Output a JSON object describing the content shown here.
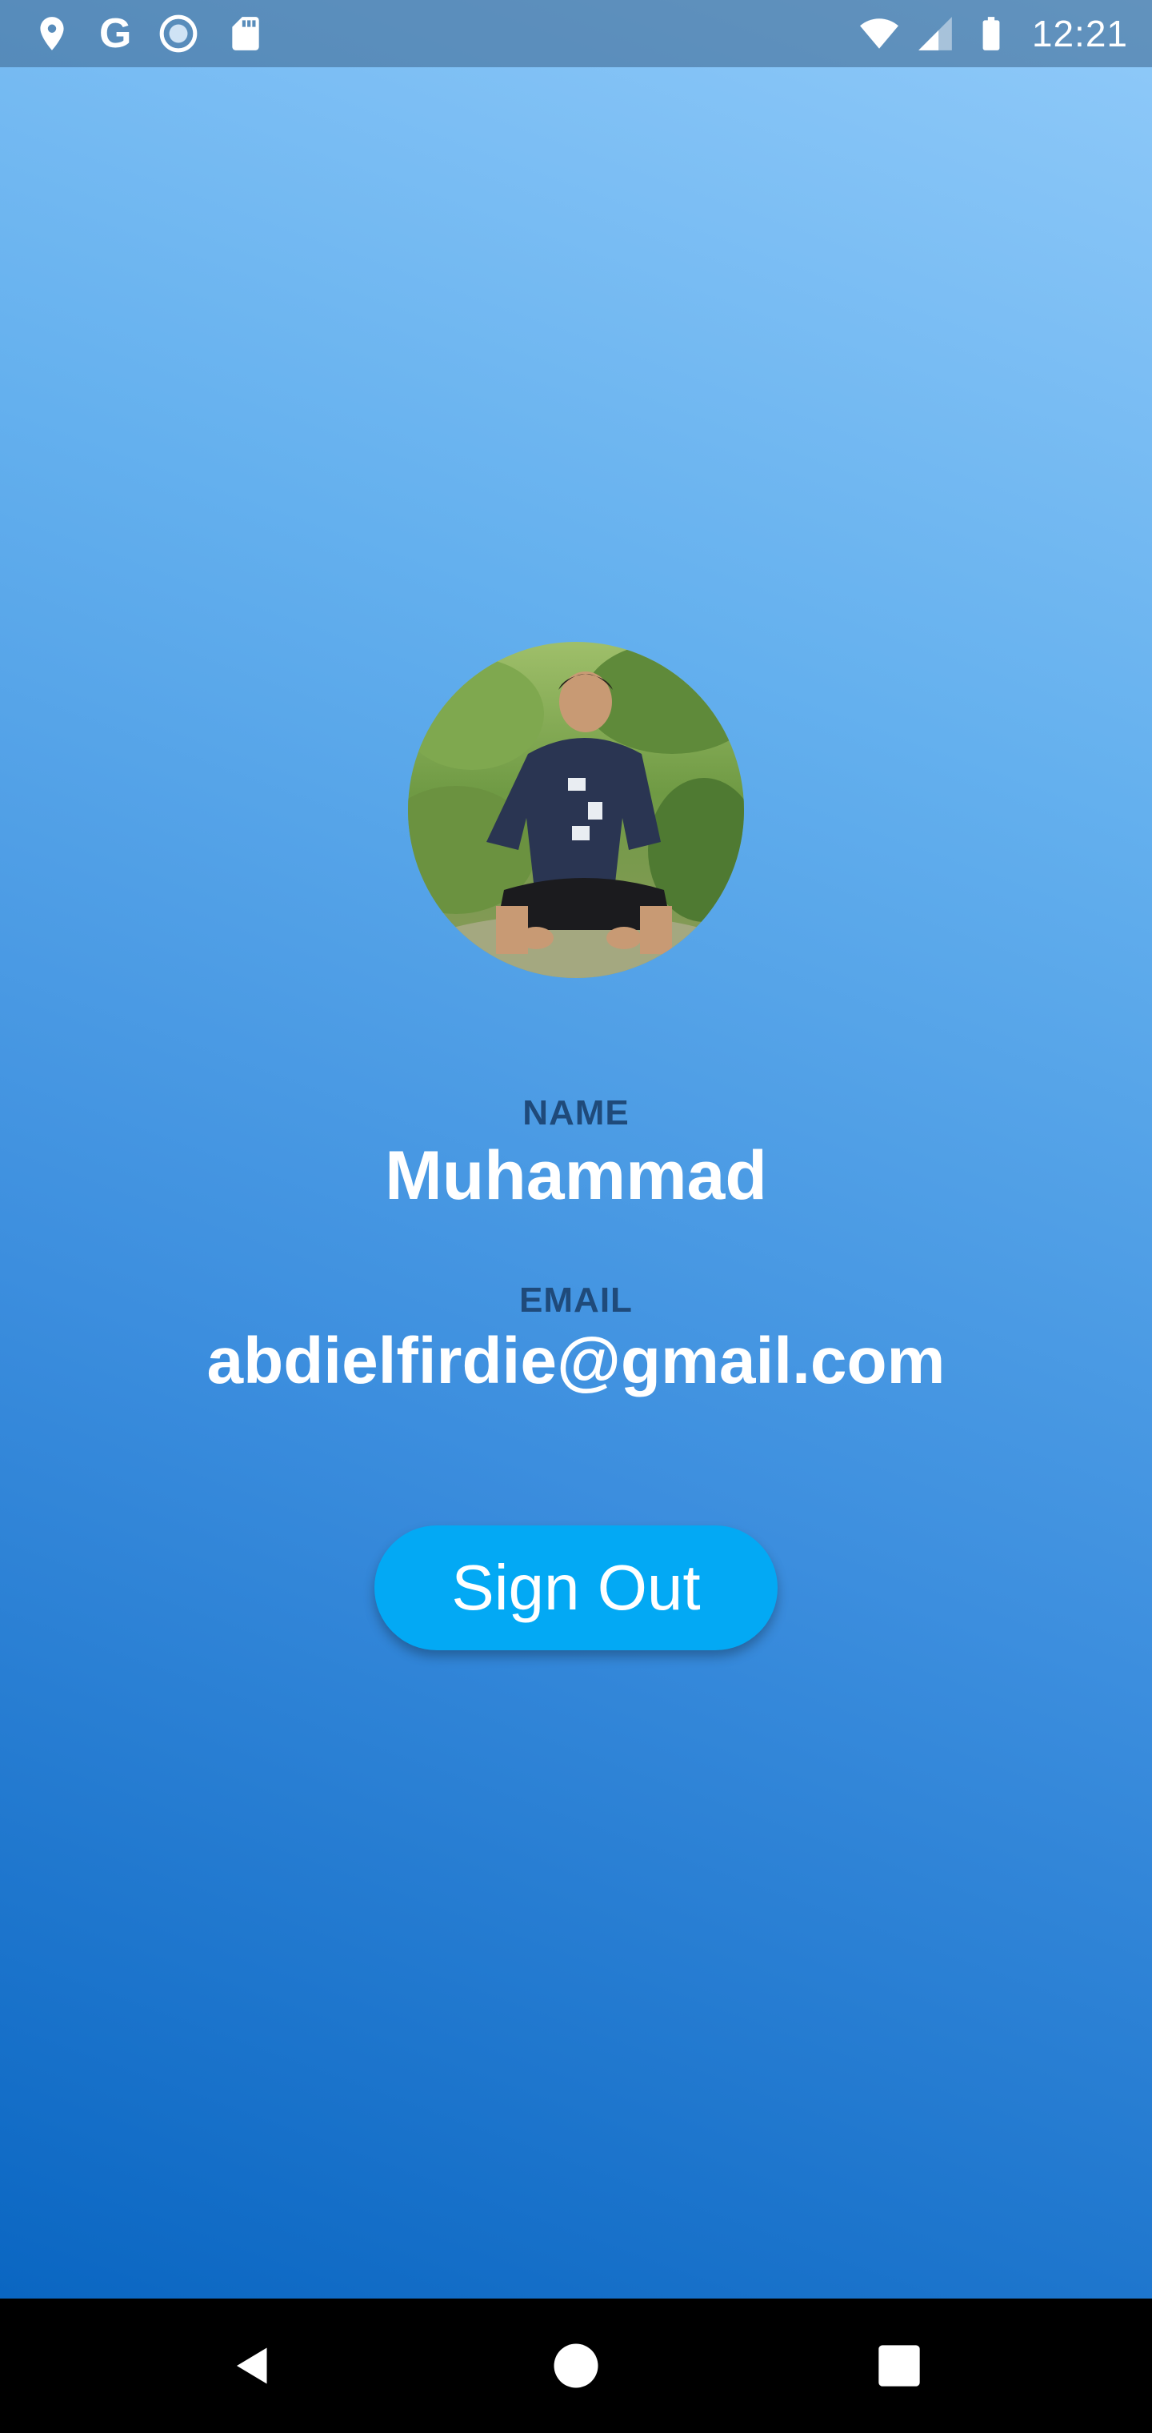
{
  "status_bar": {
    "time": "12:21",
    "left_icons": [
      "location-pin-icon",
      "google-g-icon",
      "record-icon",
      "sd-card-icon"
    ],
    "right_icons": [
      "wifi-icon",
      "cell-signal-icon",
      "battery-icon"
    ],
    "google_glyph": "G"
  },
  "profile": {
    "avatar": "profile-photo",
    "name_label": "NAME",
    "name_value": "Muhammad",
    "email_label": "EMAIL",
    "email_value": "abdielfirdie@gmail.com"
  },
  "actions": {
    "sign_out_label": "Sign Out"
  },
  "nav_bar": {
    "buttons": [
      "back-icon",
      "home-icon",
      "recents-icon"
    ]
  },
  "colors": {
    "gradient_top": "#90caf9",
    "gradient_bottom": "#0a66c2",
    "button": "#03a9f4",
    "label": "#1f4a7a"
  }
}
